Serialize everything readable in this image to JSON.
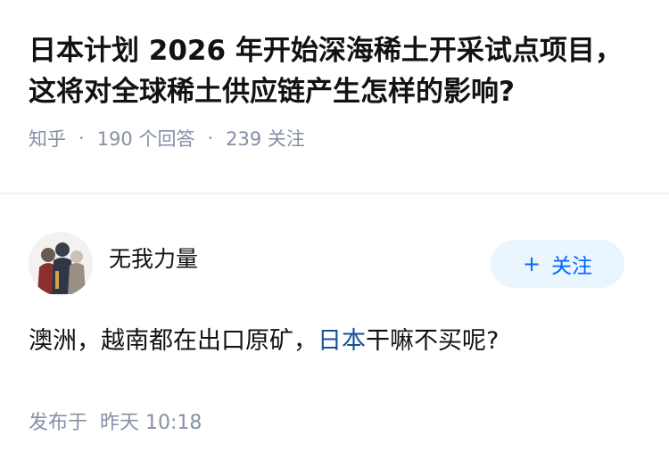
{
  "question": {
    "title": "日本计划 2026 年开始深海稀土开采试点项目，这将对全球稀土供应链产生怎样的影响?",
    "source": "知乎",
    "separator": "·",
    "answers": "190 个回答",
    "followers": "239 关注"
  },
  "answer": {
    "author": "无我力量",
    "follow_plus": "+",
    "follow_label": "关注",
    "text_before": "澳洲，越南都在出口原矿，",
    "text_link": "日本",
    "text_after": "干嘛不买呢?",
    "time_label": "发布于",
    "time_value": "昨天 10:18"
  },
  "colors": {
    "accent": "#0066ff",
    "link": "#175199",
    "meta": "#8590a6",
    "follow_bg": "#ebf5fd"
  }
}
